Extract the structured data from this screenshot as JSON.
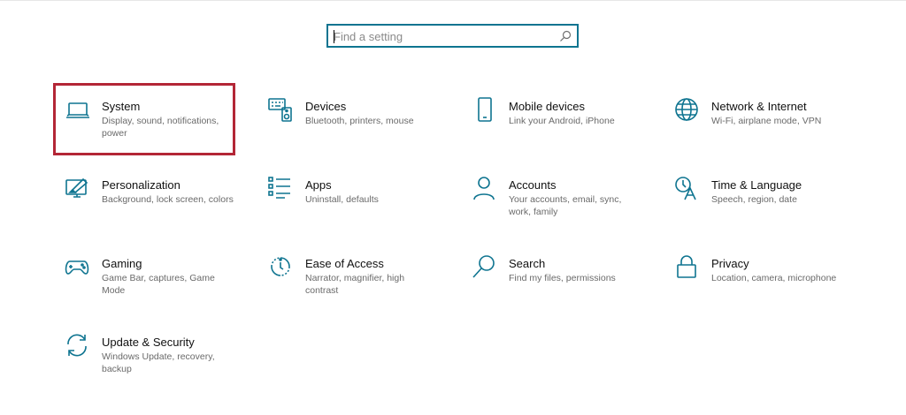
{
  "search": {
    "placeholder": "Find a setting",
    "value": ""
  },
  "accent": "#0e7490",
  "highlight_color": "#b32636",
  "highlighted_tile": "System",
  "tiles": [
    {
      "title": "System",
      "desc": "Display, sound, notifications, power",
      "icon": "laptop-icon"
    },
    {
      "title": "Devices",
      "desc": "Bluetooth, printers, mouse",
      "icon": "keyboard-speaker-icon"
    },
    {
      "title": "Mobile devices",
      "desc": "Link your Android, iPhone",
      "icon": "phone-icon"
    },
    {
      "title": "Network & Internet",
      "desc": "Wi-Fi, airplane mode, VPN",
      "icon": "globe-icon"
    },
    {
      "title": "Personalization",
      "desc": "Background, lock screen, colors",
      "icon": "paintbrush-icon"
    },
    {
      "title": "Apps",
      "desc": "Uninstall, defaults",
      "icon": "apps-list-icon"
    },
    {
      "title": "Accounts",
      "desc": "Your accounts, email, sync, work, family",
      "icon": "person-icon"
    },
    {
      "title": "Time & Language",
      "desc": "Speech, region, date",
      "icon": "time-language-icon"
    },
    {
      "title": "Gaming",
      "desc": "Game Bar, captures, Game Mode",
      "icon": "gamepad-icon"
    },
    {
      "title": "Ease of Access",
      "desc": "Narrator, magnifier, high contrast",
      "icon": "ease-of-access-icon"
    },
    {
      "title": "Search",
      "desc": "Find my files, permissions",
      "icon": "magnifier-icon"
    },
    {
      "title": "Privacy",
      "desc": "Location, camera, microphone",
      "icon": "lock-icon"
    },
    {
      "title": "Update & Security",
      "desc": "Windows Update, recovery, backup",
      "icon": "sync-arrows-icon"
    }
  ]
}
